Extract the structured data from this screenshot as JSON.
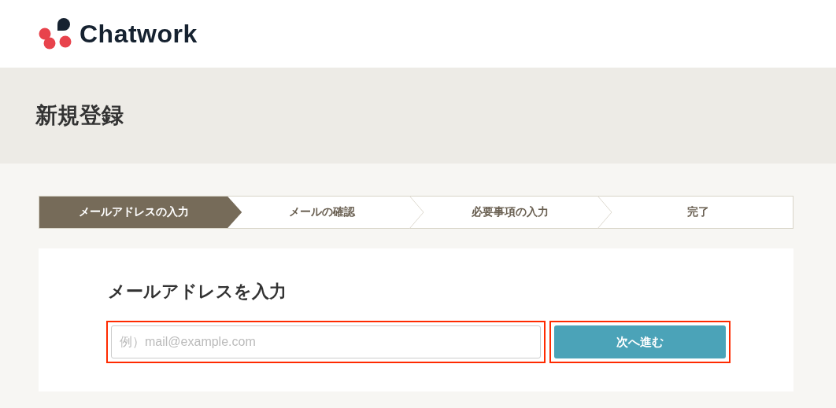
{
  "logo": {
    "name": "Chatwork"
  },
  "page_title": "新規登録",
  "steps": [
    {
      "label": "メールアドレスの入力",
      "selected": true
    },
    {
      "label": "メールの確認",
      "selected": false
    },
    {
      "label": "必要事項の入力",
      "selected": false
    },
    {
      "label": "完了",
      "selected": false
    }
  ],
  "form": {
    "heading": "メールアドレスを入力",
    "email": {
      "placeholder": "例）mail@example.com",
      "highlighted": true
    },
    "submit": {
      "label": "次へ進む",
      "highlighted": true
    }
  }
}
